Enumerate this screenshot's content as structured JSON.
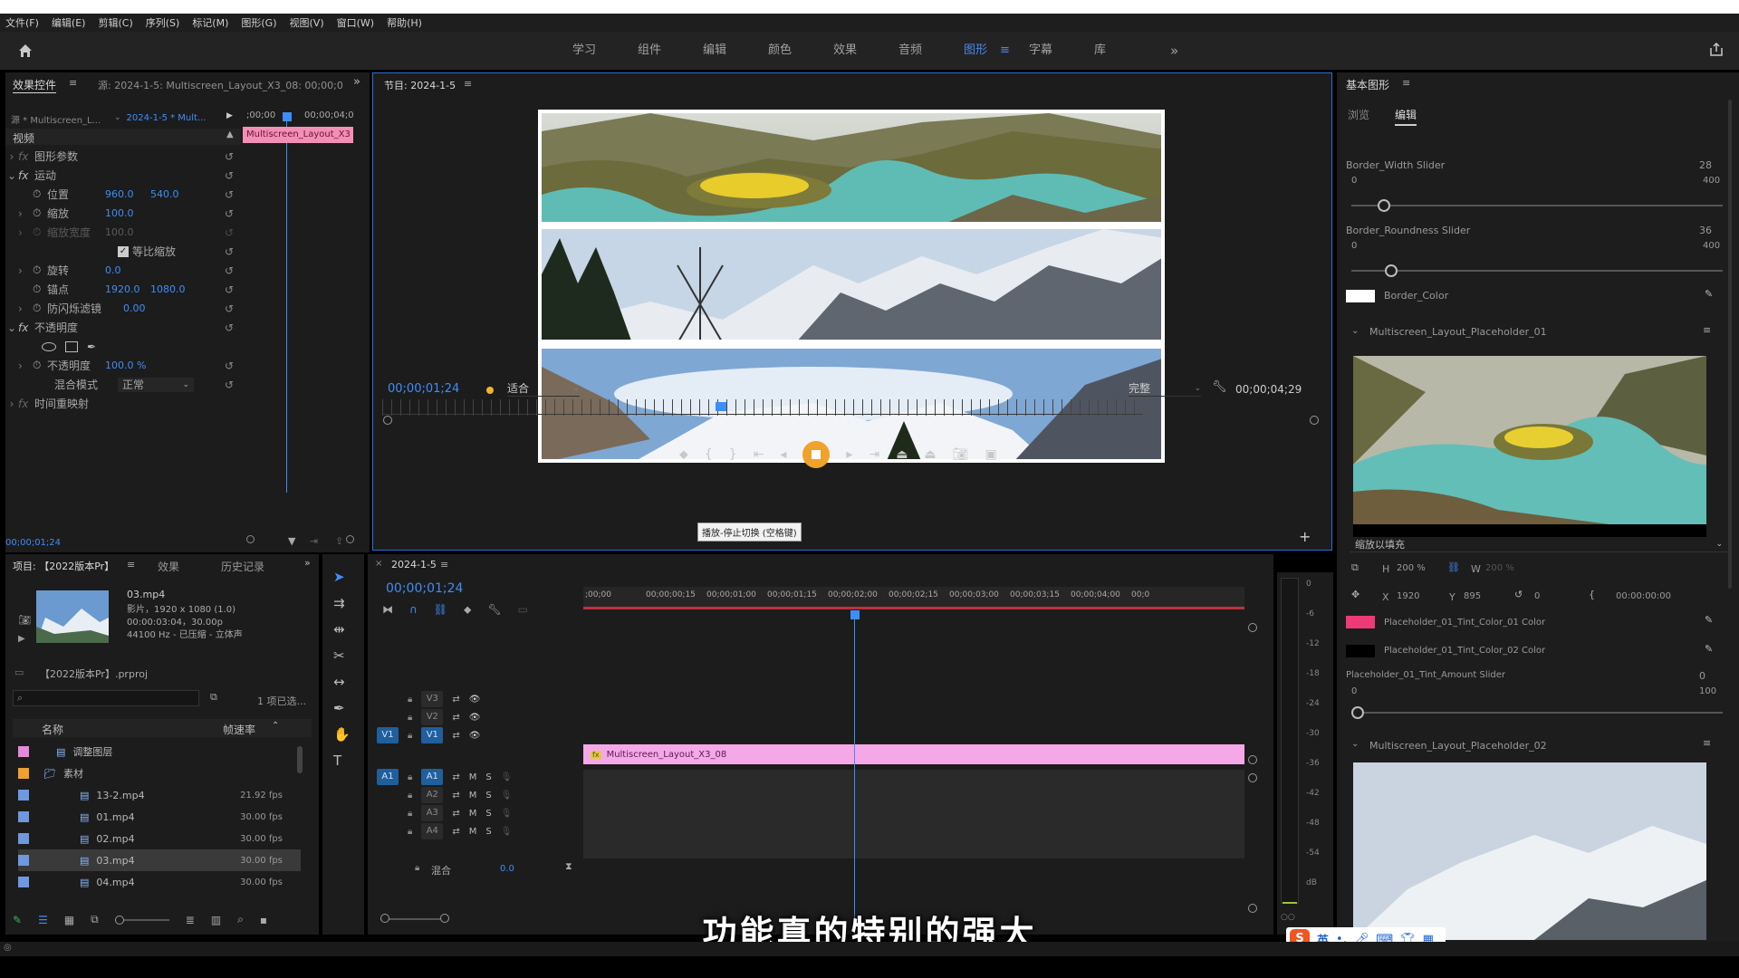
{
  "menu": [
    "文件(F)",
    "编辑(E)",
    "剪辑(C)",
    "序列(S)",
    "标记(M)",
    "图形(G)",
    "视图(V)",
    "窗口(W)",
    "帮助(H)"
  ],
  "workspaces": [
    "学习",
    "组件",
    "编辑",
    "颜色",
    "效果",
    "音频",
    "图形",
    "字幕",
    "库"
  ],
  "active_workspace": "图形",
  "effect_controls": {
    "title": "效果控件",
    "source_label": "源: 2024-1-5: Multiscreen_Layout_X3_08: 00;00;00;0",
    "clip_source": "源 * Multiscreen_L...",
    "clip_sequence": "2024-1-5 * Mult...",
    "time_start": ";00;00",
    "time_end": "00;00;04;0",
    "clip_bar_label": "Multiscreen_Layout_X3",
    "video_header": "视频",
    "props": {
      "graphic_params": "图形参数",
      "motion": "运动",
      "position": "位置",
      "position_x": "960.0",
      "position_y": "540.0",
      "scale": "缩放",
      "scale_val": "100.0",
      "scale_width": "缩放宽度",
      "scale_width_val": "100.0",
      "uniform_scale": "等比缩放",
      "rotation": "旋转",
      "rotation_val": "0.0",
      "anchor": "锚点",
      "anchor_x": "1920.0",
      "anchor_y": "1080.0",
      "antiflicker": "防闪烁滤镜",
      "antiflicker_val": "0.00",
      "opacity_group": "不透明度",
      "opacity": "不透明度",
      "opacity_val": "100.0 %",
      "blend_mode": "混合模式",
      "blend_val": "正常",
      "time_remap": "时间重映射"
    },
    "current_time": "00;00;01;24"
  },
  "program": {
    "title": "节目: 2024-1-5",
    "timecode": "00;00;01;24",
    "fit": "适合",
    "quality": "完整",
    "duration": "00;00;04;29",
    "tooltip": "播放-停止切换 (空格键)"
  },
  "essential_graphics": {
    "title": "基本图形",
    "tab_browse": "浏览",
    "tab_edit": "编辑",
    "border_width_label": "Border_Width Slider",
    "border_width_val": "28",
    "border_width_min": "0",
    "border_width_max": "400",
    "border_width_fraction": 0.07,
    "border_round_label": "Border_Roundness Slider",
    "border_round_val": "36",
    "border_round_min": "0",
    "border_round_max": "400",
    "border_round_fraction": 0.09,
    "border_color_label": "Border_Color",
    "placeholder1": "Multiscreen_Layout_Placeholder_01",
    "fill_mode": "缩放以填充",
    "h_label": "H",
    "h_val": "200 %",
    "w_label": "W",
    "w_val": "200 %",
    "x_label": "X",
    "x_val": "1920",
    "y_label": "Y",
    "y_val": "895",
    "rot_val": "0",
    "time_val": "00:00:00:00",
    "tint1": "Placeholder_01_Tint_Color_01 Color",
    "tint2": "Placeholder_01_Tint_Color_02 Color",
    "tint_amount": "Placeholder_01_Tint_Amount Slider",
    "tint_amount_val": "0",
    "tint_amount_min": "0",
    "tint_amount_max": "100",
    "tint_amount_fraction": 0,
    "placeholder2": "Multiscreen_Layout_Placeholder_02"
  },
  "project": {
    "title": "项目: 【2022版本Pr】",
    "tab_effects": "效果",
    "tab_history": "历史记录",
    "clip_name": "03.mp4",
    "clip_info1": "影片，1920 x 1080 (1.0)",
    "clip_info2": "00:00:03:04，30.00p",
    "clip_info3": "44100 Hz - 已压缩 - 立体声",
    "proj_file": "【2022版本Pr】.prproj",
    "selected_count": "1 项已选...",
    "col_name": "名称",
    "col_fps": "帧速率",
    "files": [
      {
        "name": "调整图层",
        "fps": "",
        "color": "#e58ad8"
      },
      {
        "name": "素材",
        "fps": "",
        "color": "#f0a030"
      },
      {
        "name": "13-2.mp4",
        "fps": "21.92 fps",
        "color": "#6e98e0"
      },
      {
        "name": "01.mp4",
        "fps": "30.00 fps",
        "color": "#6e98e0"
      },
      {
        "name": "02.mp4",
        "fps": "30.00 fps",
        "color": "#6e98e0"
      },
      {
        "name": "03.mp4",
        "fps": "30.00 fps",
        "color": "#6e98e0"
      },
      {
        "name": "04.mp4",
        "fps": "30.00 fps",
        "color": "#6e98e0"
      }
    ]
  },
  "timeline": {
    "title": "2024-1-5",
    "timecode": "00;00;01;24",
    "ruler": [
      ";00;00",
      "00;00;00;15",
      "00;00;01;00",
      "00;00;01;15",
      "00;00;02;00",
      "00;00;02;15",
      "00;00;03;00",
      "00;00;03;15",
      "00;00;04;00",
      "00;0"
    ],
    "clip_label": "Multiscreen_Layout_X3_08",
    "mix_label": "混合",
    "mix_val": "0.0",
    "tracks_v": [
      "V3",
      "V2",
      "V1"
    ],
    "tracks_a": [
      "A1",
      "A2",
      "A3",
      "A4"
    ]
  },
  "meter_scale": [
    "0",
    "-6",
    "-12",
    "-18",
    "-24",
    "-30",
    "-36",
    "-42",
    "-48",
    "-54",
    "dB"
  ],
  "subtitle": "功能真的特别的强大",
  "ime": {
    "lang": "英"
  }
}
